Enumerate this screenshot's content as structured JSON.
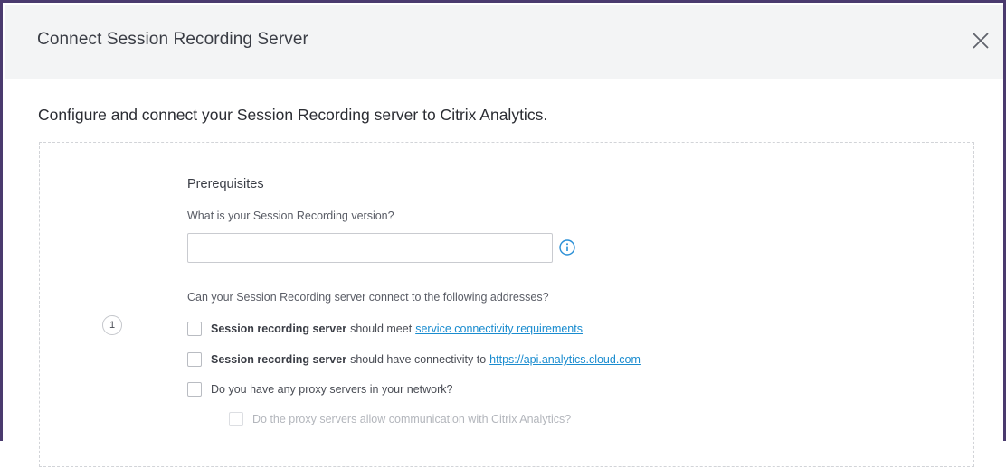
{
  "modal": {
    "title": "Connect Session Recording Server",
    "close_label": "Close"
  },
  "intro": "Configure and connect your Session Recording server to Citrix Analytics.",
  "step": {
    "number": "1",
    "section_title": "Prerequisites",
    "version_label": "What is your Session Recording version?",
    "version_value": "",
    "version_placeholder": "",
    "connect_question": "Can your Session Recording server connect to the following addresses?",
    "checks": [
      {
        "bold": "Session recording server",
        "text": "should meet",
        "link": "service connectivity requirements",
        "checked": false
      },
      {
        "bold": "Session recording server",
        "text": "should have connectivity to",
        "link": "https://api.analytics.cloud.com",
        "checked": false
      },
      {
        "text": "Do you have any proxy servers in your network?",
        "checked": false
      }
    ],
    "sub_check": {
      "text": "Do the proxy servers allow communication with Citrix Analytics?",
      "checked": false,
      "disabled": true
    }
  },
  "icons": {
    "close": "close-icon",
    "info": "info-icon"
  },
  "colors": {
    "frame_border": "#4a3a6e",
    "header_bg": "#f3f4f5",
    "link": "#1a8ccf",
    "info_icon": "#2a8fd6"
  }
}
